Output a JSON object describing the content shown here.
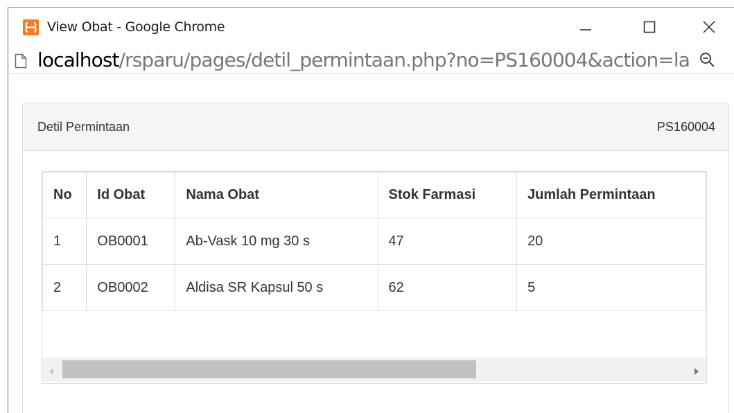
{
  "window": {
    "title": "View Obat - Google Chrome",
    "controls": {
      "minimize": "—",
      "maximize": "☐",
      "close": "✕"
    }
  },
  "address_bar": {
    "host": "localhost",
    "path": "/rsparu/pages/detil_permintaan.php?no=PS160004&action=la",
    "icons": [
      "page-icon",
      "zoom-icon"
    ]
  },
  "panel": {
    "title": "Detil Permintaan",
    "code": "PS160004"
  },
  "table": {
    "columns": [
      "No",
      "Id Obat",
      "Nama Obat",
      "Stok Farmasi",
      "Jumlah Permintaan"
    ],
    "rows": [
      [
        "1",
        "OB0001",
        "Ab-Vask 10 mg 30 s",
        "47",
        "20"
      ],
      [
        "2",
        "OB0002",
        "Aldisa SR Kapsul 50 s",
        "62",
        "5"
      ]
    ]
  },
  "scrollbar": {
    "position_fraction": 0.0,
    "visible_fraction": 0.63
  },
  "colors": {
    "app_icon": "#f47b20",
    "url_path": "#777777",
    "panel_heading": "#f5f5f5",
    "border": "#dddddd"
  }
}
